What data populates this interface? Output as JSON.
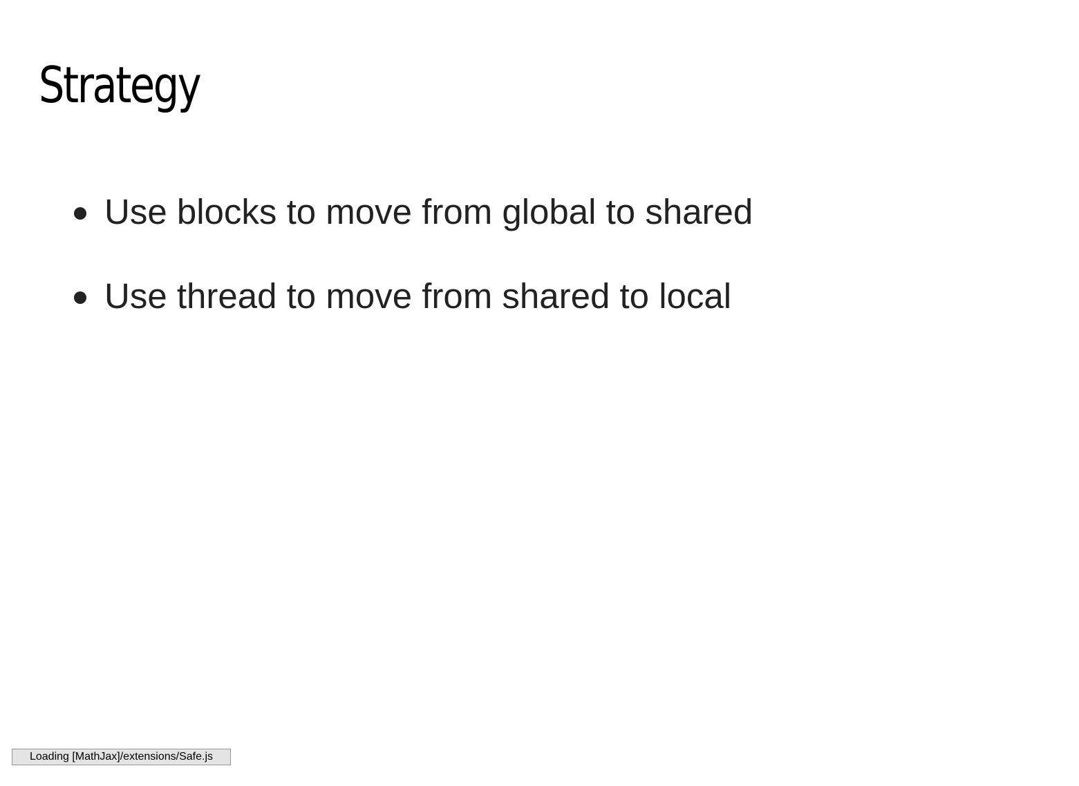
{
  "slide": {
    "title": "Strategy",
    "bullets": [
      "Use blocks to move from global to shared",
      "Use thread to move from shared to local"
    ]
  },
  "status": {
    "message": "Loading [MathJax]/extensions/Safe.js"
  },
  "colors": {
    "background": "#ffffff",
    "title": "#000000",
    "body_text": "#222222",
    "status_background": "#e4e4e4",
    "status_border": "#959595"
  }
}
